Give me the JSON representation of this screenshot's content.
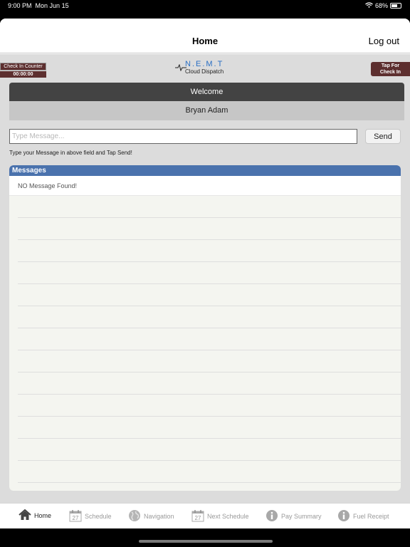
{
  "status_bar": {
    "time": "9:00 PM",
    "date": "Mon Jun 15",
    "battery": "68%",
    "battery_level": 0.68
  },
  "navbar": {
    "title": "Home",
    "logout_label": "Log out"
  },
  "checkin_counter": {
    "label": "Check In Counter",
    "time": "00:00:00"
  },
  "logo": {
    "title": "N.E.M.T",
    "subtitle": "Cloud Dispatch"
  },
  "tap_checkin": {
    "line1": "Tap For",
    "line2": "Check In"
  },
  "welcome": {
    "label": "Welcome",
    "user_name": "Bryan Adam"
  },
  "message_form": {
    "placeholder": "Type Message...",
    "value": "",
    "send_label": "Send",
    "hint": "Type your Message in above field and Tap Send!"
  },
  "messages": {
    "header": "Messages",
    "empty_text": "NO Message Found!"
  },
  "tabs": [
    {
      "label": "Home",
      "icon": "home-icon",
      "active": true
    },
    {
      "label": "Schedule",
      "icon": "calendar-icon",
      "icon_text": "27",
      "active": false
    },
    {
      "label": "Navigation",
      "icon": "globe-icon",
      "active": false
    },
    {
      "label": "Next Schedule",
      "icon": "calendar-icon",
      "icon_text": "27",
      "active": false
    },
    {
      "label": "Pay Summary",
      "icon": "info-icon",
      "active": false
    },
    {
      "label": "Fuel Receipt",
      "icon": "info-icon",
      "active": false
    }
  ],
  "colors": {
    "accent_blue": "#4a72ad",
    "checkin_brown": "#5d2f2f",
    "welcome_dark": "#434343"
  }
}
